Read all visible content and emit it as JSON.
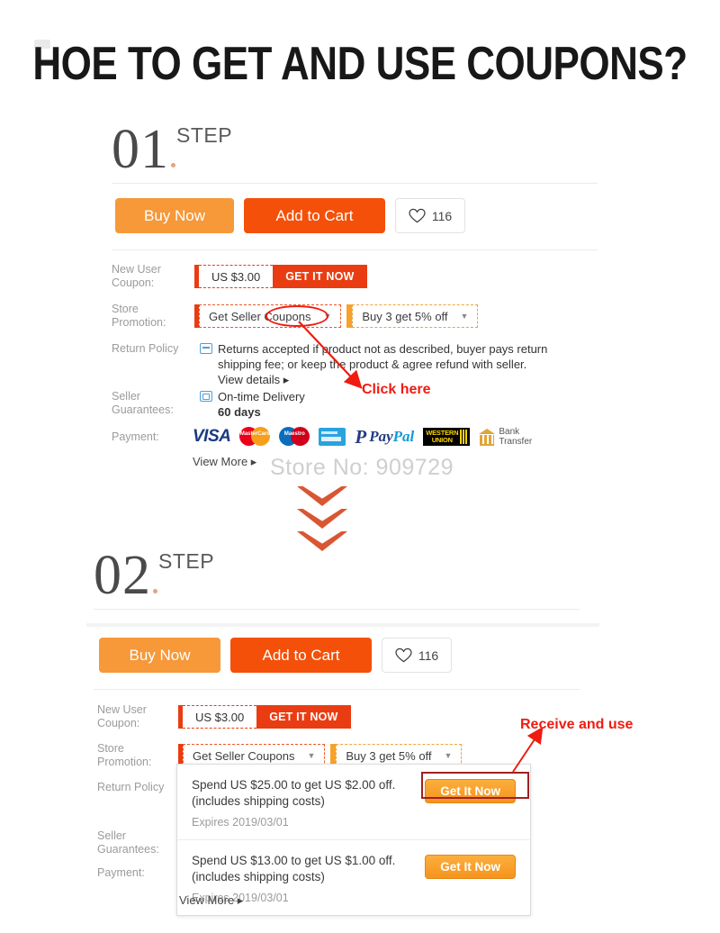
{
  "title": "HOE TO GET AND USE COUPONS?",
  "watermark": "Store No: 909729",
  "steps": [
    {
      "number": "01",
      "word": "STEP"
    },
    {
      "number": "02",
      "word": "STEP"
    }
  ],
  "actions": {
    "buy_now": "Buy Now",
    "add_to_cart": "Add to Cart",
    "wishlist_count": "116",
    "heart_icon": "heart-icon"
  },
  "labels": {
    "new_user_coupon": "New User\nCoupon:",
    "new_user_coupon_l1": "New User",
    "new_user_coupon_l2": "Coupon:",
    "store_promotion_l1": "Store",
    "store_promotion_l2": "Promotion:",
    "return_policy": "Return Policy",
    "seller_guarantees_l1": "Seller",
    "seller_guarantees_l2": "Guarantees:",
    "payment": "Payment:"
  },
  "new_user_coupon": {
    "amount": "US $3.00",
    "cta": "GET IT NOW"
  },
  "store_promotion": {
    "seller_coupons": "Get Seller Coupons",
    "bulk_deal": "Buy 3 get 5% off",
    "caret_icon": "chevron-down-icon"
  },
  "return_policy": {
    "line1": "Returns accepted if product not as described, buyer pays return",
    "line2": "shipping fee; or keep the product & agree refund with seller.",
    "view_details": "View details ▸",
    "icon": "return-box-icon"
  },
  "seller_guarantees": {
    "delivery": "On-time Delivery",
    "days": "60 days",
    "icon": "delivery-truck-icon"
  },
  "payment": {
    "methods": [
      "visa-icon",
      "mastercard-icon",
      "maestro-icon",
      "bank-card-icon",
      "paypal-icon",
      "western-union-icon",
      "bank-transfer-icon"
    ],
    "visa_label": "VISA",
    "mastercard_label": "MasterCard",
    "maestro_label": "Maestro",
    "paypal_mark": "P",
    "paypal_pay": "Pay",
    "paypal_pal": "Pal",
    "wu_line1": "WESTERN",
    "wu_line2": "UNION",
    "bank_line1": "Bank",
    "bank_line2": "Transfer"
  },
  "view_more": "View More ▸",
  "annotations": {
    "click_here": "Click here",
    "receive_and_use": "Receive and use"
  },
  "coupon_dropdown": {
    "items": [
      {
        "line1": "Spend US $25.00 to get US $2.00 off.",
        "line2": "(includes shipping costs)",
        "expires": "Expires 2019/03/01",
        "cta": "Get It Now"
      },
      {
        "line1": "Spend US $13.00 to get US $1.00 off.",
        "line2": "(includes shipping costs)",
        "expires": "Expires 2019/03/01",
        "cta": "Get It Now"
      }
    ]
  },
  "colors": {
    "buy_now": "#f79839",
    "add_to_cart": "#f45009",
    "coupon_red": "#ea3c12",
    "promo_orange": "#f0a13c",
    "annotation_red": "#ee1c11",
    "chevron": "#d95632",
    "get_it_now": "#f6931e"
  }
}
